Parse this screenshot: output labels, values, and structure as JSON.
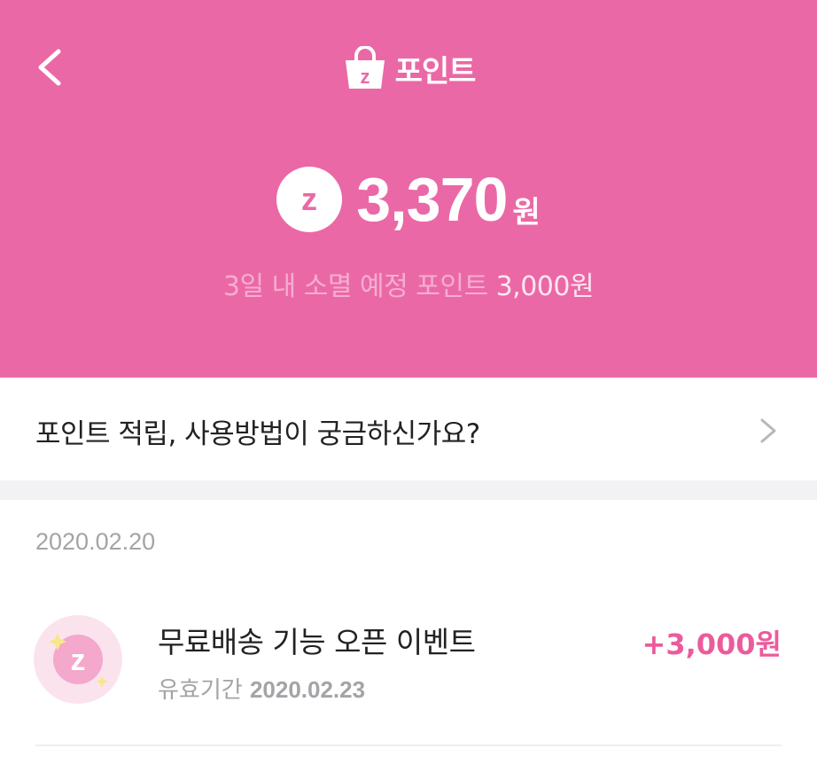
{
  "colors": {
    "brand_pink": "#eb68a6",
    "accent_pink": "#eb5b9c",
    "light_pink": "#fbe3ee",
    "gray_text": "#a4a4a8",
    "divider": "#f2f2f4"
  },
  "header": {
    "back_icon": "chevron-left-icon",
    "title_icon": "shopping-bag-z-icon",
    "title": "포인트"
  },
  "balance": {
    "coin_icon": "z-coin-icon",
    "amount": "3,370",
    "unit": "원",
    "expiring_label": "3일 내 소멸 예정 포인트",
    "expiring_amount": "3,000원"
  },
  "help": {
    "label": "포인트 적립, 사용방법이 궁금하신가요?",
    "icon": "chevron-right-icon"
  },
  "history": {
    "groups": [
      {
        "date": "2020.02.20",
        "entries": [
          {
            "icon": "z-sparkle-icon",
            "title": "무료배송 기능 오픈 이벤트",
            "validity_label": "유효기간",
            "validity_date": "2020.02.23",
            "amount": "+3,000원"
          }
        ]
      }
    ]
  }
}
